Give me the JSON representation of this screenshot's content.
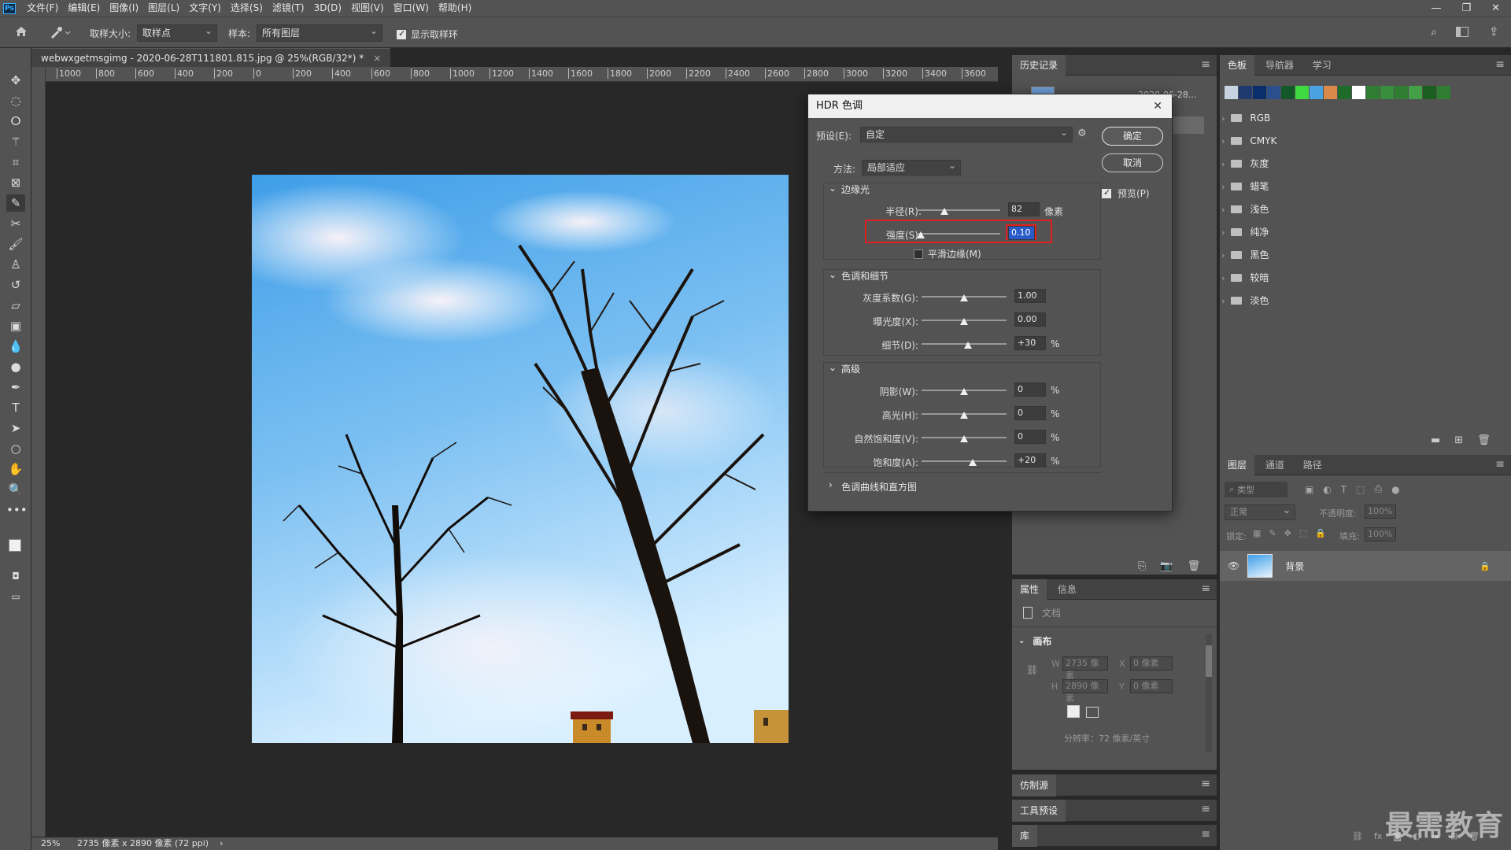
{
  "app": {
    "logo": "Ps"
  },
  "menu": [
    "文件(F)",
    "编辑(E)",
    "图像(I)",
    "图层(L)",
    "文字(Y)",
    "选择(S)",
    "滤镜(T)",
    "3D(D)",
    "视图(V)",
    "窗口(W)",
    "帮助(H)"
  ],
  "window_controls": [
    "—",
    "❐",
    "✕"
  ],
  "options_bar": {
    "sample_size_label": "取样大小:",
    "sample_size_value": "取样点",
    "sample_label": "样本:",
    "sample_value": "所有图层",
    "show_ring_label": "显示取样环",
    "show_ring_checked": true
  },
  "document": {
    "tab_title": "webwxgetmsgimg - 2020-06-28T111801.815.jpg @ 25%(RGB/32*) *",
    "close": "×",
    "ruler_ticks": [
      "1000",
      "800",
      "600",
      "400",
      "200",
      "0",
      "200",
      "400",
      "600",
      "800",
      "1000",
      "1200",
      "1400",
      "1600",
      "1800",
      "2000",
      "2200",
      "2400",
      "2600",
      "2800",
      "3000",
      "3200",
      "3400",
      "3600"
    ]
  },
  "status": {
    "zoom": "25%",
    "doc_info": "2735 像素 x 2890 像素 (72 ppi)",
    "arrow": "›"
  },
  "history_panel": {
    "tab": "历史记录",
    "entry_date": "2020-06-28..."
  },
  "swatches_panel": {
    "tabs": [
      "色板",
      "导航器",
      "学习"
    ],
    "swatch_colors": [
      "#c7d3e0",
      "#1f3a6e",
      "#0a2d6b",
      "#2a4f8c",
      "#14582a",
      "#3fd940",
      "#4aa3e0",
      "#d98a4a",
      "#1f6b2a",
      "#ffffff",
      "#2e7d32",
      "#388e3c",
      "#2e7d32",
      "#43a047",
      "#1b5e20",
      "#2e7d32"
    ],
    "folders": [
      "RGB",
      "CMYK",
      "灰度",
      "蜡笔",
      "浅色",
      "纯净",
      "黑色",
      "较暗",
      "淡色"
    ]
  },
  "layers_panel": {
    "tabs": [
      "图层",
      "通道",
      "路径"
    ],
    "filter_placeholder": "类型",
    "blend_mode": "正常",
    "opacity_label": "不透明度:",
    "opacity_value": "100%",
    "lock_label": "锁定:",
    "fill_label": "填充:",
    "fill_value": "100%",
    "layer_name": "背景"
  },
  "properties_panel": {
    "tabs": [
      "属性",
      "信息"
    ],
    "doc_label": "文档",
    "section": "画布",
    "w_label": "W",
    "w_value": "2735 像素",
    "h_label": "H",
    "h_value": "2890 像素",
    "x_label": "X",
    "x_value": "0 像素",
    "y_label": "Y",
    "y_value": "0 像素",
    "resolution": "分辨率：72 像素/英寸"
  },
  "collapsed_panels": [
    "仿制源",
    "工具预设",
    "库"
  ],
  "dialog": {
    "title": "HDR 色调",
    "preset_label": "预设(E):",
    "preset_value": "自定",
    "method_label": "方法:",
    "method_value": "局部适应",
    "ok": "确定",
    "cancel": "取消",
    "preview_label": "预览(P)",
    "preview_checked": true,
    "edge_glow": {
      "title": "边缘光",
      "radius_label": "半径(R):",
      "radius_value": "82",
      "radius_unit": "像素",
      "radius_level": 0.33,
      "strength_label": "强度(S):",
      "strength_value": "0.10",
      "strength_level": 0.05,
      "smooth_label": "平滑边缘(M)",
      "smooth_checked": false
    },
    "tone_detail": {
      "title": "色调和细节",
      "gamma_label": "灰度系数(G):",
      "gamma_value": "1.00",
      "gamma_level": 0.5,
      "exposure_label": "曝光度(X):",
      "exposure_value": "0.00",
      "exposure_level": 0.5,
      "detail_label": "细节(D):",
      "detail_value": "+30",
      "detail_unit": "%",
      "detail_level": 0.55
    },
    "advanced": {
      "title": "高级",
      "shadow_label": "阴影(W):",
      "shadow_value": "0",
      "highlight_label": "高光(H):",
      "highlight_value": "0",
      "vibrance_label": "自然饱和度(V):",
      "vibrance_value": "0",
      "saturation_label": "饱和度(A):",
      "saturation_value": "+20",
      "unit": "%",
      "shadow_level": 0.5,
      "highlight_level": 0.5,
      "vibrance_level": 0.5,
      "saturation_level": 0.6
    },
    "curve_section": "色调曲线和直方图"
  },
  "watermark": "最需教育"
}
